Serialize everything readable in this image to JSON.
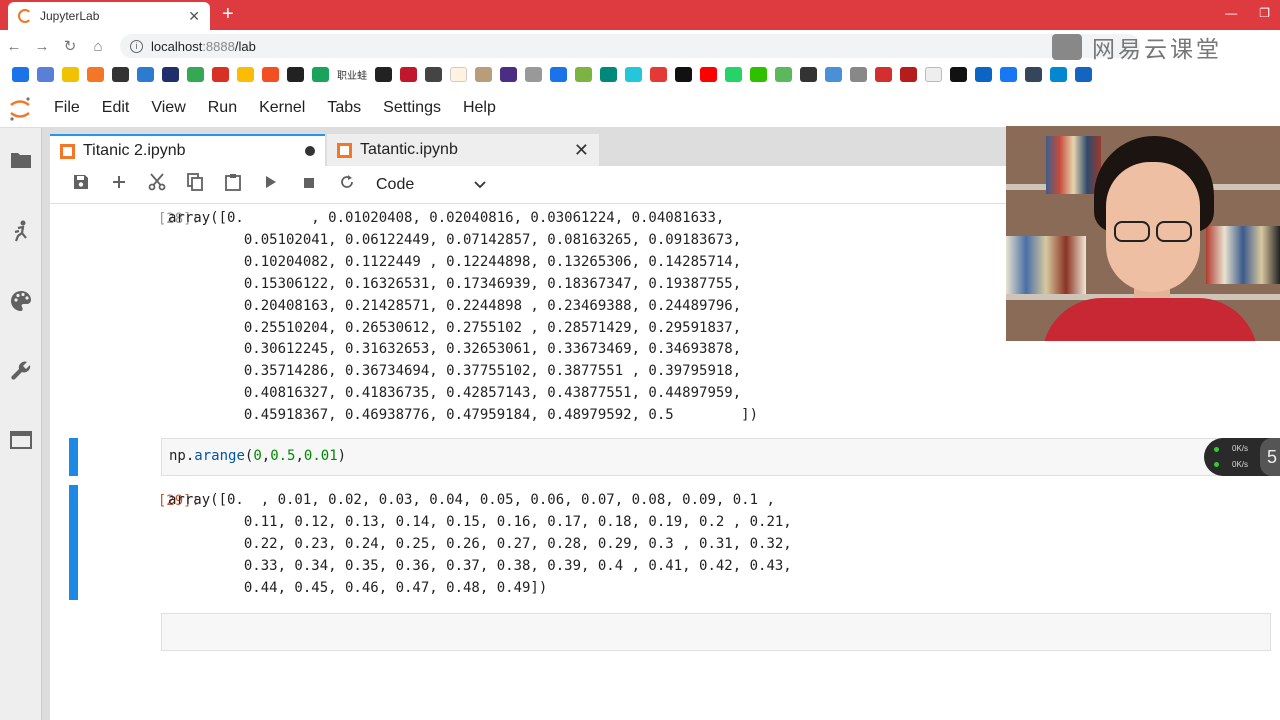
{
  "browser": {
    "tab_title": "JupyterLab",
    "tab_close": "✕",
    "new_tab": "+",
    "url_host": "localhost",
    "url_port": ":8888",
    "url_path": "/lab",
    "watermark": "网易云课堂",
    "window_min": "—",
    "window_restore": "❐",
    "bookmark_label": "职业蛙"
  },
  "menu": {
    "items": [
      "File",
      "Edit",
      "View",
      "Run",
      "Kernel",
      "Tabs",
      "Settings",
      "Help"
    ]
  },
  "tabs": [
    {
      "label": "Titanic 2.ipynb",
      "dirty": true
    },
    {
      "label": "Tatantic.ipynb",
      "close": "✕"
    }
  ],
  "toolbar": {
    "cell_type": "Code"
  },
  "cells": {
    "out28": {
      "prompt": "[28]:",
      "text": "array([0.        , 0.01020408, 0.02040816, 0.03061224, 0.04081633,\n         0.05102041, 0.06122449, 0.07142857, 0.08163265, 0.09183673,\n         0.10204082, 0.1122449 , 0.12244898, 0.13265306, 0.14285714,\n         0.15306122, 0.16326531, 0.17346939, 0.18367347, 0.19387755,\n         0.20408163, 0.21428571, 0.2244898 , 0.23469388, 0.24489796,\n         0.25510204, 0.26530612, 0.2755102 , 0.28571429, 0.29591837,\n         0.30612245, 0.31632653, 0.32653061, 0.33673469, 0.34693878,\n         0.35714286, 0.36734694, 0.37755102, 0.3877551 , 0.39795918,\n         0.40816327, 0.41836735, 0.42857143, 0.43877551, 0.44897959,\n         0.45918367, 0.46938776, 0.47959184, 0.48979592, 0.5        ])"
    },
    "in29": {
      "prompt": "[29]:",
      "code_prefix": "np.",
      "code_fn": "arange",
      "code_open": "(",
      "arg1": "0",
      "sep1": ",",
      "arg2": "0.5",
      "sep2": ",",
      "arg3": "0.01",
      "code_close": ")"
    },
    "out29": {
      "prompt": "[29]:",
      "text": "array([0.  , 0.01, 0.02, 0.03, 0.04, 0.05, 0.06, 0.07, 0.08, 0.09, 0.1 ,\n         0.11, 0.12, 0.13, 0.14, 0.15, 0.16, 0.17, 0.18, 0.19, 0.2 , 0.21,\n         0.22, 0.23, 0.24, 0.25, 0.26, 0.27, 0.28, 0.29, 0.3 , 0.31, 0.32,\n         0.33, 0.34, 0.35, 0.36, 0.37, 0.38, 0.39, 0.4 , 0.41, 0.42, 0.43,\n         0.44, 0.45, 0.46, 0.47, 0.48, 0.49])"
    },
    "empty": {
      "prompt": "[ ]:"
    }
  },
  "speed_widget": {
    "up": "0K/s",
    "down": "0K/s",
    "badge": "5"
  }
}
